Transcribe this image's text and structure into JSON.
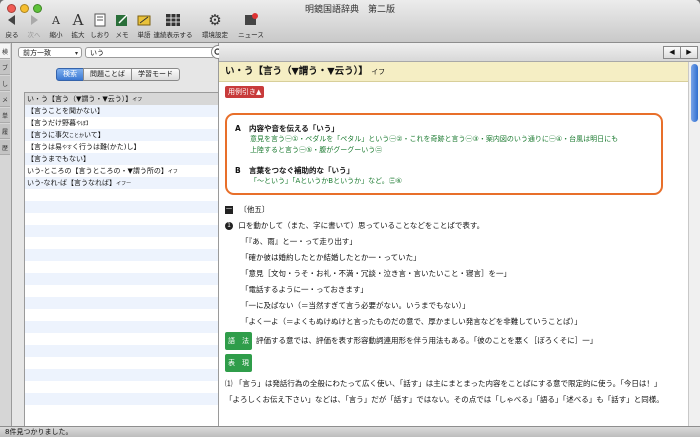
{
  "window": {
    "title": "明鏡国語辞典　第二版"
  },
  "toolbar": {
    "items": [
      {
        "label": "戻る",
        "icon": "back-arrow"
      },
      {
        "label": "次へ",
        "icon": "forward-arrow"
      },
      {
        "label": "縮小",
        "icon": "font-smaller"
      },
      {
        "label": "拡大",
        "icon": "font-larger"
      },
      {
        "label": "しおり",
        "icon": "bookmark"
      },
      {
        "label": "メモ",
        "icon": "memo"
      },
      {
        "label": "単語",
        "icon": "word-card"
      },
      {
        "label": "連続表示する",
        "icon": "continuous-view"
      },
      {
        "label": "環境設定",
        "icon": "gear"
      },
      {
        "label": "ニュース",
        "icon": "news"
      }
    ]
  },
  "sidebar_tabs": [
    "検",
    "ブ",
    "し",
    "メ",
    "単",
    "履",
    "歴"
  ],
  "search": {
    "mode": "前方一致",
    "query": "いう",
    "tabs": [
      "検索",
      "問題ことば",
      "学習モード"
    ],
    "active_tab": "検索"
  },
  "results": [
    {
      "main": "い・う【言う（▼謂う・▼云う）】",
      "sub": "イフ"
    },
    {
      "main": "【言うことを聞かない】",
      "sub": ""
    },
    {
      "main": "【言うだけ野暮",
      "sub": "やぼ】"
    },
    {
      "main": "【言うに事欠",
      "sub": "ことか",
      "tail": "いて】"
    },
    {
      "main": "【言うは易",
      "sub": "やす",
      "tail": "く行うは難(かた)し】"
    },
    {
      "main": "【言うまでもない】",
      "sub": ""
    },
    {
      "main": "いう-ところの【言うところの・▼謂う所の】",
      "sub": "イフ"
    },
    {
      "main": "いう-なれ-ば【言うなれば】",
      "sub": "イフー"
    }
  ],
  "entry": {
    "headword": "い・う【言う（▼謂う・▼云う）】",
    "reading": "イフ",
    "usage_tag": "用例引き▲",
    "usage": [
      {
        "letter": "A",
        "heading": "内容や音を伝える「いう」",
        "lines": [
          "意見を言う㊀①・ペダルを「ペタル」という㊀②・これを奇跡と言う㊀③・案内図のいう通りに㊀④・台風は明日にも",
          "上陸すると言う㊀⑤・腹がグーグーいう㊁"
        ]
      },
      {
        "letter": "B",
        "heading": "言葉をつなぐ補助的な「いう」",
        "lines": [
          "「〜という」「AというかBというか」など。㊂⑥"
        ]
      }
    ],
    "section_mark": "一",
    "section_type": "〔他五〕",
    "def_num": "1",
    "definition": "口を動かして（また、字に書いて）思っていることなどをことばで表す。",
    "examples": [
      "「『あ、雨』と一・って走り出す」",
      "「確か彼は婚約したとか結婚したとか一・っていた」",
      "「意見［文句・うそ・お礼・不満・冗談・泣き言・言いたいこと・寝言］を一」",
      "「電話するように一・っておきます」",
      "「一に及ばない（＝当然すぎて言う必要がない。いうまでもない）」",
      "「よく一よ（＝よくもぬけぬけと言ったものだの意で、厚かましい発言などを非難していうことば）」"
    ],
    "gohou_tag": "語　法",
    "gohou_text": "評価する意では、評価を表す形容動詞連用形を伴う用法もある。「彼のことを悪く［ぼろくそに］一」",
    "hyoki_tag": "表　現",
    "hyoki_lines": [
      "⑴ 「言う」は発話行為の全般にわたって広く使い、「話す」は主にまとまった内容をことばにする意で限定的に使う。「今日は！」",
      "「よろしくお伝え下さい」などは、「言う」だが「話す」ではない。その点では「しゃべる」「語る」「述べる」も「話す」と同様。"
    ]
  },
  "status": "8件見つかりました。"
}
